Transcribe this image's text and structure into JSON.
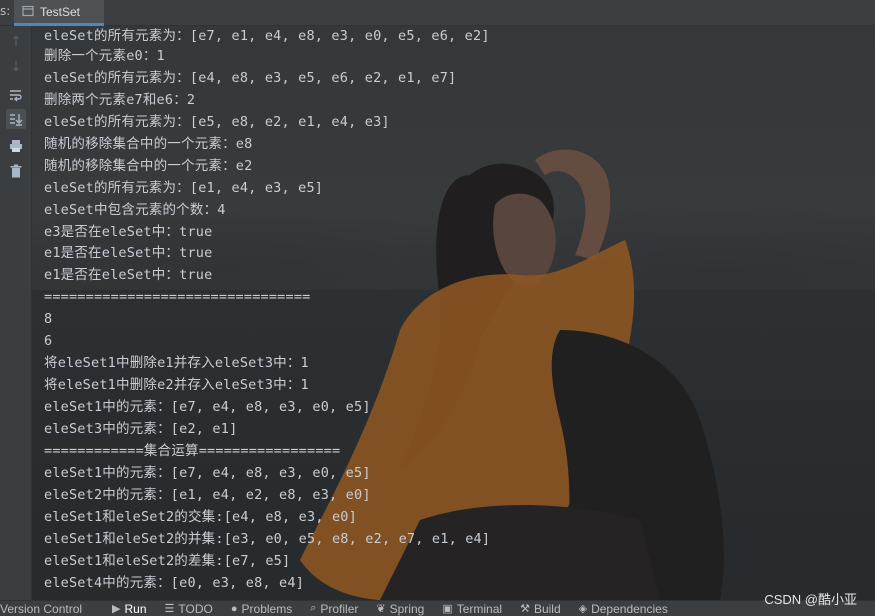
{
  "tabbar": {
    "prefix": "s:",
    "tab_title": "TestSet",
    "tab_icon": "console-tab-icon"
  },
  "gutter": {
    "buttons": [
      {
        "name": "up-arrow-icon",
        "glyph": "↑"
      },
      {
        "name": "down-arrow-icon",
        "glyph": "↓"
      },
      {
        "name": "soft-wrap-icon",
        "glyph": "⤶"
      },
      {
        "name": "scroll-to-end-icon",
        "glyph": "⤓"
      },
      {
        "name": "print-icon",
        "glyph": "⎙"
      },
      {
        "name": "trash-icon",
        "glyph": "🗑"
      }
    ]
  },
  "console": {
    "lines": [
      "eleSet的所有元素为：[e7, e1, e4, e8, e3, e0, e5, e6, e2]",
      "删除一个元素e0：1",
      "eleSet的所有元素为：[e4, e8, e3, e5, e6, e2, e1, e7]",
      "删除两个元素e7和e6：2",
      "eleSet的所有元素为：[e5, e8, e2, e1, e4, e3]",
      "随机的移除集合中的一个元素：e8",
      "随机的移除集合中的一个元素：e2",
      "eleSet的所有元素为：[e1, e4, e3, e5]",
      "eleSet中包含元素的个数：4",
      "e3是否在eleSet中：true",
      "e1是否在eleSet中：true",
      "e1是否在eleSet中：true",
      "================================",
      "8",
      "6",
      "将eleSet1中删除e1并存入eleSet3中：1",
      "将eleSet1中删除e2并存入eleSet3中：1",
      "eleSet1中的元素：[e7, e4, e8, e3, e0, e5]",
      "eleSet3中的元素：[e2, e1]",
      "============集合运算=================",
      "eleSet1中的元素：[e7, e4, e8, e3, e0, e5]",
      "eleSet2中的元素：[e1, e4, e2, e8, e3, e0]",
      "eleSet1和eleSet2的交集:[e4, e8, e3, e0]",
      "eleSet1和eleSet2的并集:[e3, e0, e5, e8, e2, e7, e1, e4]",
      "eleSet1和eleSet2的差集:[e7, e5]",
      "eleSet4中的元素：[e0, e3, e8, e4]"
    ]
  },
  "statusbar": {
    "items": [
      {
        "name": "version-control",
        "label": "Version Control",
        "icon": "",
        "icon_name": ""
      },
      {
        "name": "run",
        "label": "Run",
        "icon": "▶",
        "icon_name": "play-icon"
      },
      {
        "name": "todo",
        "label": "TODO",
        "icon": "☰",
        "icon_name": "list-icon"
      },
      {
        "name": "problems",
        "label": "Problems",
        "icon": "●",
        "icon_name": "problems-icon"
      },
      {
        "name": "profiler",
        "label": "Profiler",
        "icon": "⌕",
        "icon_name": "profiler-icon"
      },
      {
        "name": "spring",
        "label": "Spring",
        "icon": "❦",
        "icon_name": "spring-leaf-icon"
      },
      {
        "name": "terminal",
        "label": "Terminal",
        "icon": "▣",
        "icon_name": "terminal-icon"
      },
      {
        "name": "build",
        "label": "Build",
        "icon": "⚒",
        "icon_name": "hammer-icon"
      },
      {
        "name": "dependencies",
        "label": "Dependencies",
        "icon": "◈",
        "icon_name": "dependencies-icon"
      }
    ]
  },
  "watermark": "CSDN @酷小亚",
  "colors": {
    "console_text": "#c8ced4",
    "tab_underline": "#4a88c7",
    "panel_bg": "#3c3f41",
    "figure_orange": "#b8681e"
  }
}
